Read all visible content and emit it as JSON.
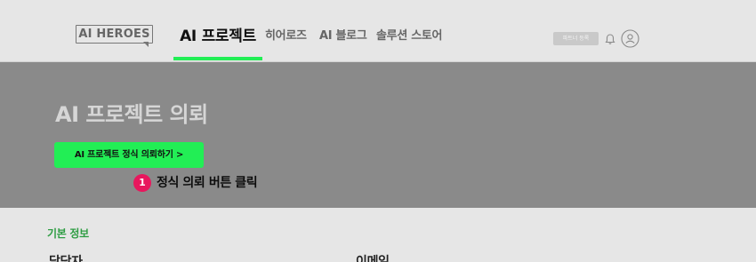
{
  "header": {
    "logo_text": "AI HEROES",
    "nav": [
      {
        "label": "AI 프로젝트",
        "active": true
      },
      {
        "label": "히어로즈"
      },
      {
        "label": "AI 블로그"
      },
      {
        "label": "솔루션 스토어"
      }
    ],
    "partner_button_label": "파트너 등록",
    "icons": [
      "bell-icon",
      "user-icon"
    ]
  },
  "hero": {
    "title": "AI 프로젝트 의뢰",
    "cta_label": "AI 프로젝트 정식 의뢰하기 >",
    "annotation": {
      "number": "1",
      "text": "정식 의뢰 버튼 클릭",
      "color": "#e8175d"
    }
  },
  "form": {
    "section_title": "기본 정보",
    "fields": [
      {
        "label": "담당자"
      },
      {
        "label": "이메일"
      }
    ]
  },
  "colors": {
    "accent": "#22ee55",
    "hero_bg": "#8a8a8a",
    "section_title": "#2e9d43"
  }
}
